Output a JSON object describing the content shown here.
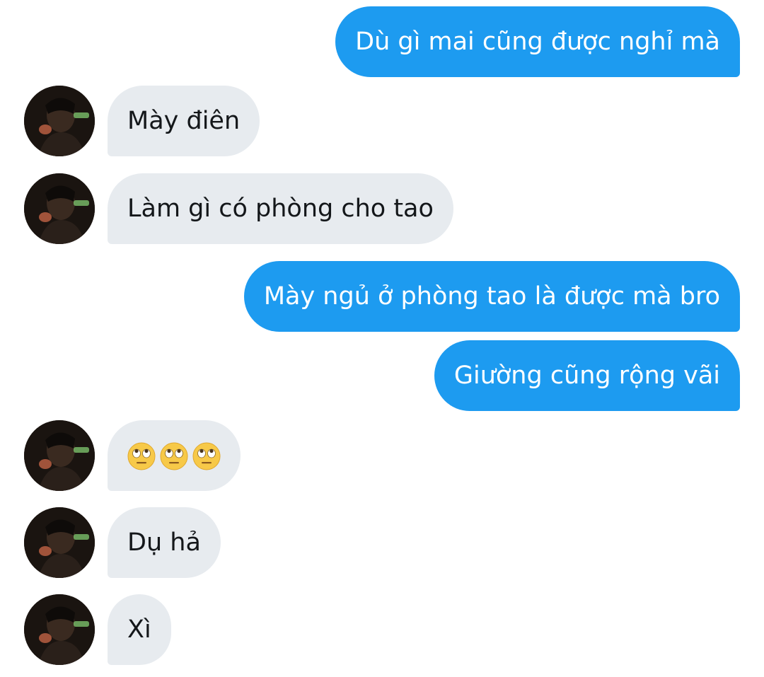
{
  "conversation": {
    "messages": [
      {
        "direction": "sent",
        "text": "Dù gì mai cũng được nghỉ mà"
      },
      {
        "direction": "received",
        "text": "Mày điên"
      },
      {
        "direction": "received",
        "text": "Làm gì có phòng cho tao"
      },
      {
        "direction": "sent",
        "text": "Mày ngủ ở phòng tao là được mà bro"
      },
      {
        "direction": "sent",
        "text": "Giường cũng rộng vãi"
      },
      {
        "direction": "received",
        "emoji": [
          "face-with-rolling-eyes",
          "face-with-rolling-eyes",
          "face-with-rolling-eyes"
        ]
      },
      {
        "direction": "received",
        "text": "Dụ hả"
      },
      {
        "direction": "received",
        "text": "Xì"
      }
    ]
  },
  "colors": {
    "sent_bubble": "#1d9bf0",
    "received_bubble": "#e7ebef",
    "sent_text": "#ffffff",
    "received_text": "#14171a"
  },
  "icons": {
    "avatar": "user-avatar",
    "emoji": "face-with-rolling-eyes"
  }
}
